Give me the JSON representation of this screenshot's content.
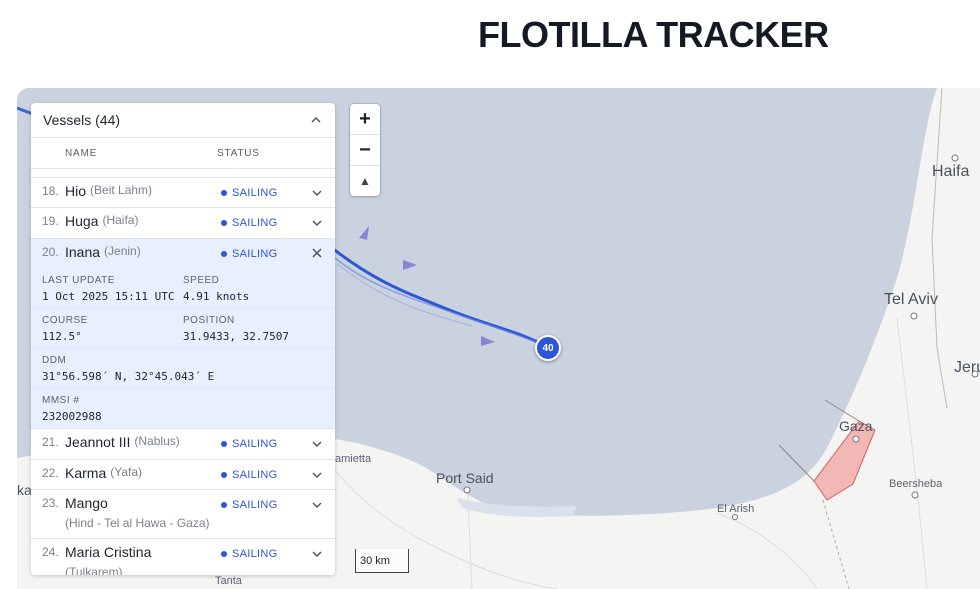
{
  "header": {
    "title": "FLOTILLA TRACKER"
  },
  "map": {
    "places": {
      "haifa": "Haifa",
      "tel_aviv": "Tel Aviv",
      "jerusalem_partial": "Jeru",
      "gaza": "Gaza",
      "beersheba": "Beersheba",
      "el_arish": "El Arish",
      "port_said": "Port Said",
      "damietta_partial": "amietta",
      "tanta": "Tanta",
      "left_partial": "ka"
    },
    "zoom": {
      "in": "+",
      "out": "−",
      "north": "▲"
    },
    "scale_label": "30 km",
    "marker_label": "40",
    "colors": {
      "sea": "#c9d2de",
      "land": "#f4f4f2",
      "track": "#2c55d8",
      "gaza_fill": "#f2b8b5"
    }
  },
  "vessels_panel": {
    "title": "Vessels (44)",
    "columns": {
      "name": "NAME",
      "status": "STATUS"
    },
    "rows": [
      {
        "num": "18.",
        "name": "Hio",
        "sub": "(Beit Lahm)",
        "status": "SAILING"
      },
      {
        "num": "19.",
        "name": "Huga",
        "sub": "(Haifa)",
        "status": "SAILING"
      },
      {
        "num": "20.",
        "name": "Inana",
        "sub": "(Jenin)",
        "status": "SAILING"
      },
      {
        "num": "21.",
        "name": "Jeannot III",
        "sub": "(Nablus)",
        "status": "SAILING"
      },
      {
        "num": "22.",
        "name": "Karma",
        "sub": "(Yafa)",
        "status": "SAILING"
      },
      {
        "num": "23.",
        "name": "Mango",
        "sub": "(Hind - Tel al Hawa - Gaza)",
        "status": "SAILING"
      },
      {
        "num": "24.",
        "name": "Maria Cristina",
        "sub": "(Tulkarem)",
        "status": "SAILING"
      }
    ],
    "details": {
      "last_update_label": "LAST UPDATE",
      "last_update": "1 Oct 2025 15:11 UTC",
      "speed_label": "SPEED",
      "speed": "4.91 knots",
      "course_label": "COURSE",
      "course": "112.5°",
      "position_label": "POSITION",
      "position": "31.9433, 32.7507",
      "ddm_label": "DDM",
      "ddm": "31°56.598´ N, 32°45.043´ E",
      "mmsi_label": "MMSI #",
      "mmsi": "232002988"
    }
  }
}
